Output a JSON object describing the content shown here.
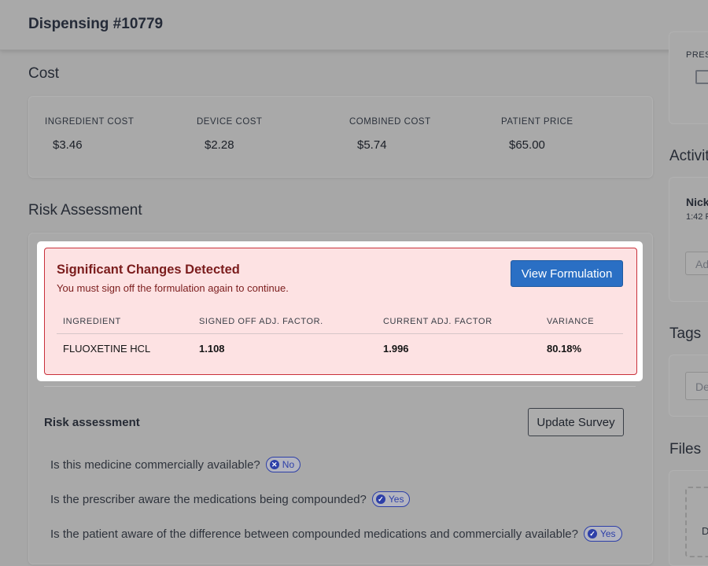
{
  "header": {
    "title": "Dispensing #10779"
  },
  "cost": {
    "section_title": "Cost",
    "items": [
      {
        "label": "INGREDIENT COST",
        "value": "$3.46"
      },
      {
        "label": "DEVICE COST",
        "value": "$2.28"
      },
      {
        "label": "COMBINED COST",
        "value": "$5.74"
      },
      {
        "label": "PATIENT PRICE",
        "value": "$65.00"
      }
    ]
  },
  "risk": {
    "section_title": "Risk Assessment",
    "alert": {
      "title": "Significant Changes Detected",
      "subtitle": "You must sign off the formulation again to continue.",
      "button_label": "View Formulation",
      "table": {
        "headers": [
          "INGREDIENT",
          "SIGNED OFF ADJ. FACTOR.",
          "CURRENT ADJ. FACTOR",
          "VARIANCE"
        ],
        "rows": [
          [
            "FLUOXETINE HCL",
            "1.108",
            "1.996",
            "80.18%"
          ]
        ]
      },
      "colors": {
        "background": "#fde2e3",
        "border": "#c9303b",
        "text": "#7b1d1d"
      }
    },
    "subsection_title": "Risk assessment",
    "update_button_label": "Update Survey",
    "questions": [
      {
        "text": "Is this medicine commercially available?",
        "answer": "No",
        "icon": "x-circle-icon"
      },
      {
        "text": "Is the prescriber aware the medications being compounded?",
        "answer": "Yes",
        "icon": "check-circle-icon"
      },
      {
        "text": "Is the patient aware of the difference between compounded medications and commercially available?",
        "answer": "Yes",
        "icon": "check-circle-icon"
      }
    ]
  },
  "sidebar": {
    "pres_label": "PRES",
    "activity_title": "Activit",
    "activity_user": "Nick",
    "activity_time": "1:42 F",
    "activity_input_placeholder": "Ad",
    "tags_title": "Tags",
    "tags_input_placeholder": "De",
    "files_title": "Files",
    "files_drop_text": "D"
  },
  "accent_color": "#2a6fc4"
}
